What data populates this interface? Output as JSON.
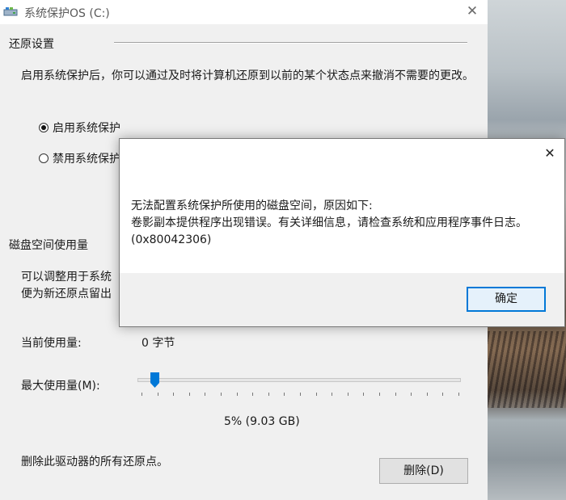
{
  "window": {
    "title": "系统保护OS (C:)",
    "close_glyph": "✕"
  },
  "restore_settings": {
    "group_title": "还原设置",
    "description": "启用系统保护后，你可以通过及时将计算机还原到以前的某个状态点来撤消不需要的更改。",
    "options": [
      {
        "label": "启用系统保护",
        "checked": true
      },
      {
        "label": "禁用系统保护",
        "checked": false
      }
    ]
  },
  "disk_usage": {
    "section_title": "磁盘空间使用量",
    "description_line1": "可以调整用于系统",
    "description_line2": "便为新还原点留出",
    "current_label": "当前使用量:",
    "current_value": "0 字节",
    "max_label": "最大使用量(M):",
    "slider_value_percent": 5,
    "slider_readout": "5% (9.03 GB)",
    "delete_text": "删除此驱动器的所有还原点。",
    "delete_button": "删除(D)"
  },
  "dialog": {
    "close_glyph": "✕",
    "line1": "无法配置系统保护所使用的磁盘空间，原因如下:",
    "line2": "卷影副本提供程序出现错误。有关详细信息，请检查系统和应用程序事件日志。",
    "line3": "(0x80042306)",
    "ok_button": "确定"
  },
  "colors": {
    "accent": "#0078d7",
    "window_bg": "#f0f0f0",
    "dialog_bg": "#ffffff"
  }
}
